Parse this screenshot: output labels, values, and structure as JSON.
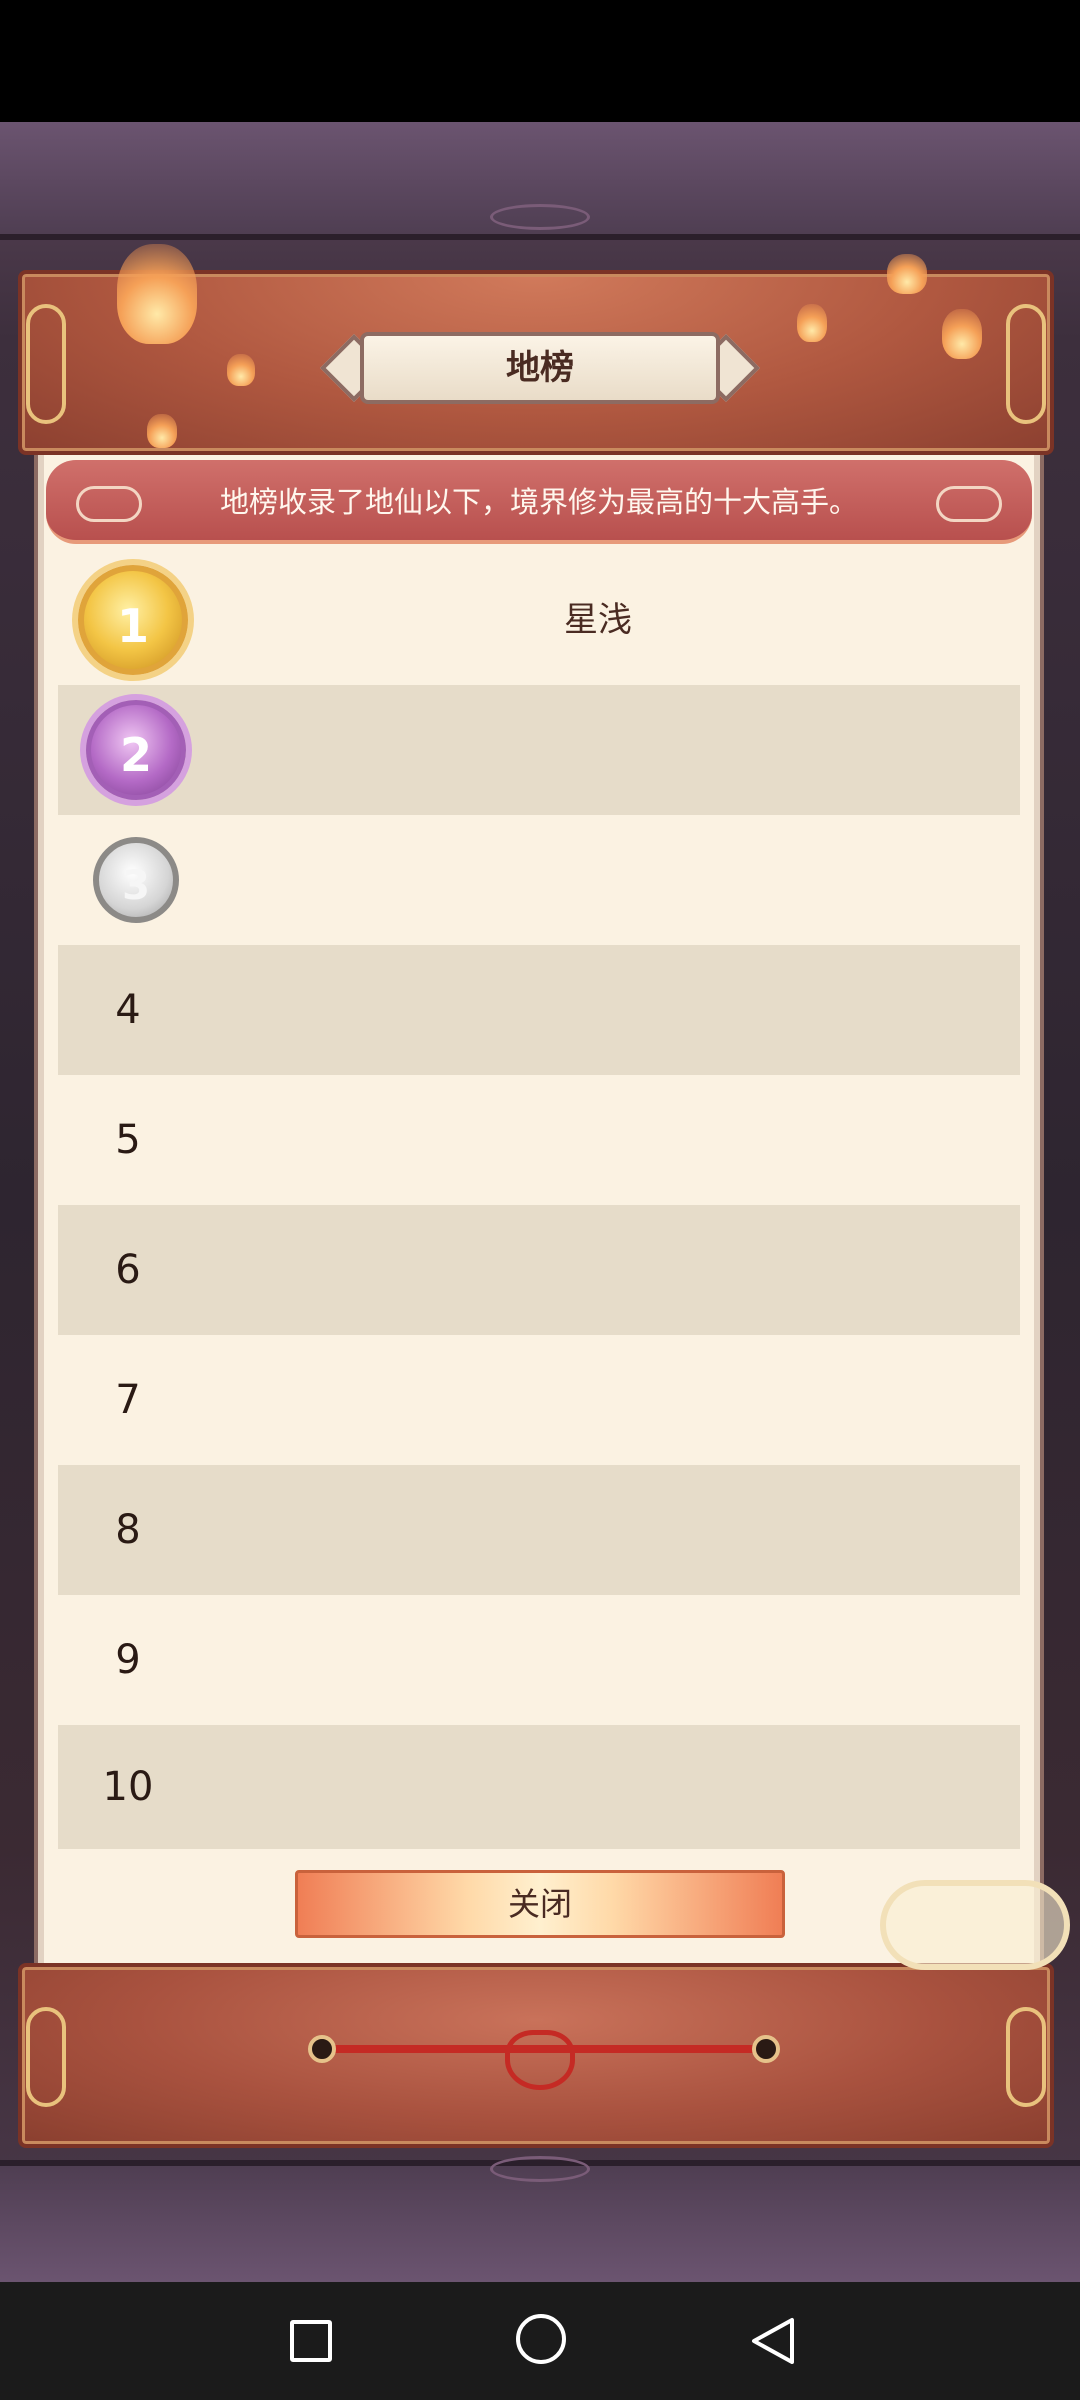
{
  "window": {
    "title": "地榜"
  },
  "banner": {
    "text": "地榜收录了地仙以下，境界修为最高的十大高手。"
  },
  "ranks": [
    {
      "rank": "1",
      "name": "星浅",
      "medal": "gold-medal-icon"
    },
    {
      "rank": "2",
      "name": "",
      "medal": "purple-medal-icon"
    },
    {
      "rank": "3",
      "name": "",
      "medal": "silver-medal-icon"
    },
    {
      "rank": "4",
      "name": ""
    },
    {
      "rank": "5",
      "name": ""
    },
    {
      "rank": "6",
      "name": ""
    },
    {
      "rank": "7",
      "name": ""
    },
    {
      "rank": "8",
      "name": ""
    },
    {
      "rank": "9",
      "name": ""
    },
    {
      "rank": "10",
      "name": ""
    }
  ],
  "buttons": {
    "close_label": "关闭"
  },
  "colors": {
    "paper": "#fbf2e2",
    "row_alt": "#e6dcc9",
    "banner": "#b8504e",
    "scroll": "#b05840",
    "close_button": "#f07e55"
  },
  "nav_bar": {
    "items": [
      "recent-apps-icon",
      "home-icon",
      "back-icon"
    ]
  }
}
